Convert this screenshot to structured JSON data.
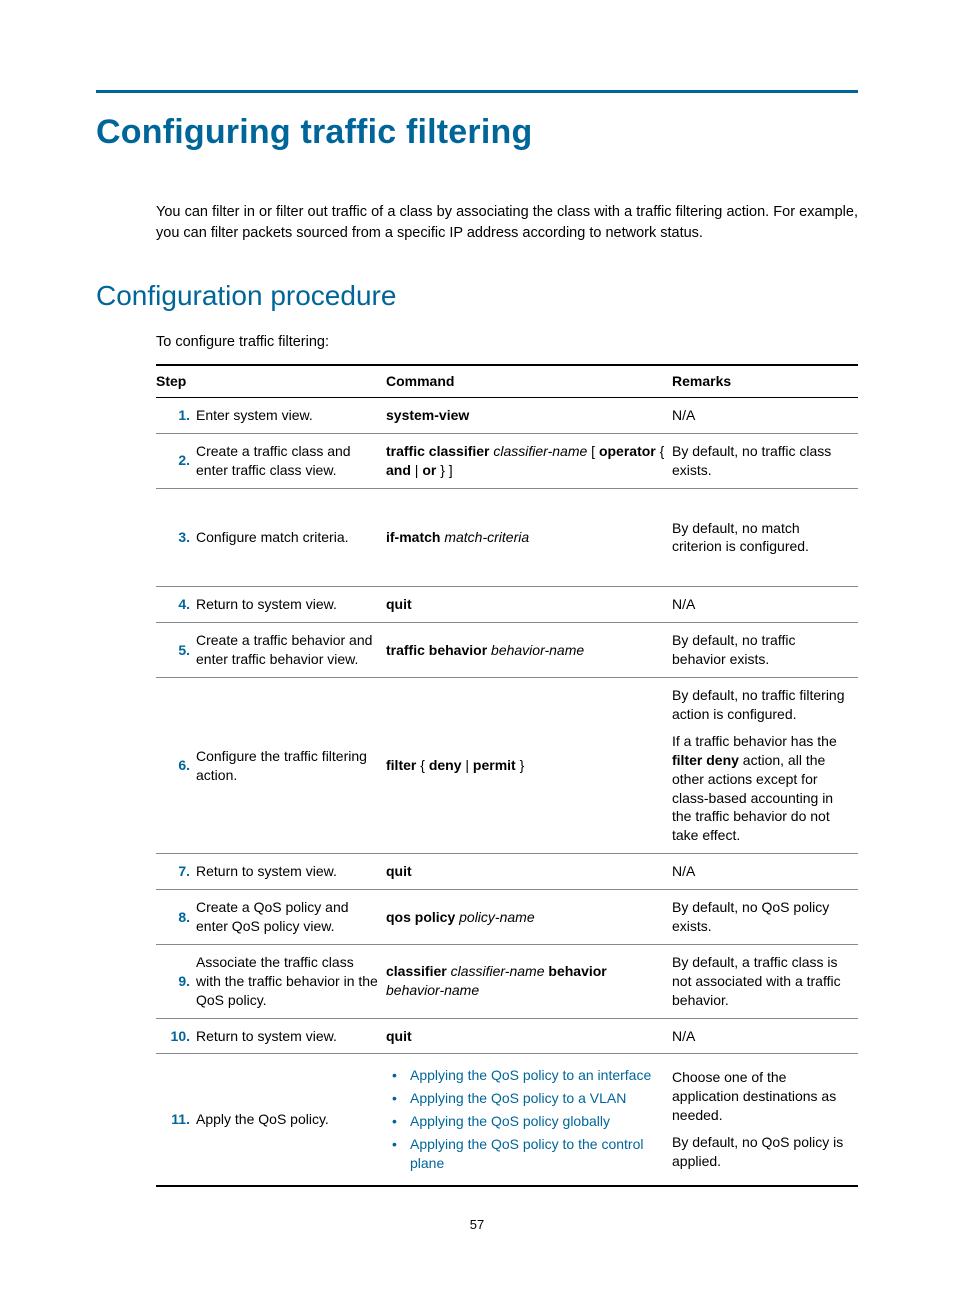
{
  "title": "Configuring traffic filtering",
  "intro": "You can filter in or filter out traffic of a class by associating the class with a traffic filtering action. For example, you can filter packets sourced from a specific IP address according to network status.",
  "subtitle": "Configuration procedure",
  "lead": "To configure traffic filtering:",
  "headers": {
    "step": "Step",
    "command": "Command",
    "remarks": "Remarks"
  },
  "rows": [
    {
      "n": "1.",
      "desc": "Enter system view.",
      "cmd": [
        {
          "b": "system-view"
        }
      ],
      "rem": [
        {
          "t": "N/A"
        }
      ]
    },
    {
      "n": "2.",
      "desc": "Create a traffic class and enter traffic class view.",
      "cmd": [
        {
          "b": "traffic classifier"
        },
        {
          "t": " "
        },
        {
          "i": "classifier-name"
        },
        {
          "t": " [ "
        },
        {
          "b": "operator"
        },
        {
          "t": " { "
        },
        {
          "b": "and"
        },
        {
          "t": " | "
        },
        {
          "b": "or"
        },
        {
          "t": " } ]"
        }
      ],
      "rem": [
        {
          "t": "By default, no traffic class exists."
        }
      ]
    },
    {
      "n": "3.",
      "desc": "Configure match criteria.",
      "cmd": [
        {
          "b": "if-match"
        },
        {
          "t": " "
        },
        {
          "i": "match-criteria"
        }
      ],
      "rem": [
        {
          "t": "By default, no match criterion is configured."
        }
      ],
      "tall": true
    },
    {
      "n": "4.",
      "desc": "Return to system view.",
      "cmd": [
        {
          "b": "quit"
        }
      ],
      "rem": [
        {
          "t": "N/A"
        }
      ]
    },
    {
      "n": "5.",
      "desc": "Create a traffic behavior and enter traffic behavior view.",
      "cmd": [
        {
          "b": "traffic behavior"
        },
        {
          "t": " "
        },
        {
          "i": "behavior-name"
        }
      ],
      "rem": [
        {
          "t": "By default, no traffic behavior exists."
        }
      ]
    },
    {
      "n": "6.",
      "desc": "Configure the traffic filtering action.",
      "cmd": [
        {
          "b": "filter"
        },
        {
          "t": " { "
        },
        {
          "b": "deny"
        },
        {
          "t": " | "
        },
        {
          "b": "permit"
        },
        {
          "t": " }"
        }
      ],
      "rem": [
        {
          "t": "By default, no traffic filtering action is configured."
        },
        {
          "p2": [
            {
              "t": "If a traffic behavior has the "
            },
            {
              "b": "filter deny"
            },
            {
              "t": " action, all the other actions except for class-based accounting in the traffic behavior do not take effect."
            }
          ]
        }
      ]
    },
    {
      "n": "7.",
      "desc": "Return to system view.",
      "cmd": [
        {
          "b": "quit"
        }
      ],
      "rem": [
        {
          "t": "N/A"
        }
      ]
    },
    {
      "n": "8.",
      "desc": "Create a QoS policy and enter QoS policy view.",
      "cmd": [
        {
          "b": "qos policy"
        },
        {
          "t": " "
        },
        {
          "i": "policy-name"
        }
      ],
      "rem": [
        {
          "t": "By default, no QoS policy exists."
        }
      ]
    },
    {
      "n": "9.",
      "desc": "Associate the traffic class with the traffic behavior in the QoS policy.",
      "cmd": [
        {
          "b": "classifier"
        },
        {
          "t": " "
        },
        {
          "i": "classifier-name"
        },
        {
          "t": " "
        },
        {
          "b": "behavior"
        },
        {
          "t": " "
        },
        {
          "i": "behavior-name"
        }
      ],
      "rem": [
        {
          "t": "By default, a traffic class is not associated with a traffic behavior."
        }
      ]
    },
    {
      "n": "10.",
      "desc": "Return to system view.",
      "cmd": [
        {
          "b": "quit"
        }
      ],
      "rem": [
        {
          "t": "N/A"
        }
      ]
    },
    {
      "n": "11.",
      "desc": "Apply the QoS policy.",
      "links": [
        "Applying the QoS policy to an interface",
        "Applying the QoS policy to a VLAN",
        "Applying the QoS policy globally",
        "Applying the QoS policy to the control plane"
      ],
      "rem": [
        {
          "t": "Choose one of the application destinations as needed."
        },
        {
          "p2": [
            {
              "t": "By default, no QoS policy is applied."
            }
          ]
        }
      ]
    }
  ],
  "pageNumber": "57"
}
